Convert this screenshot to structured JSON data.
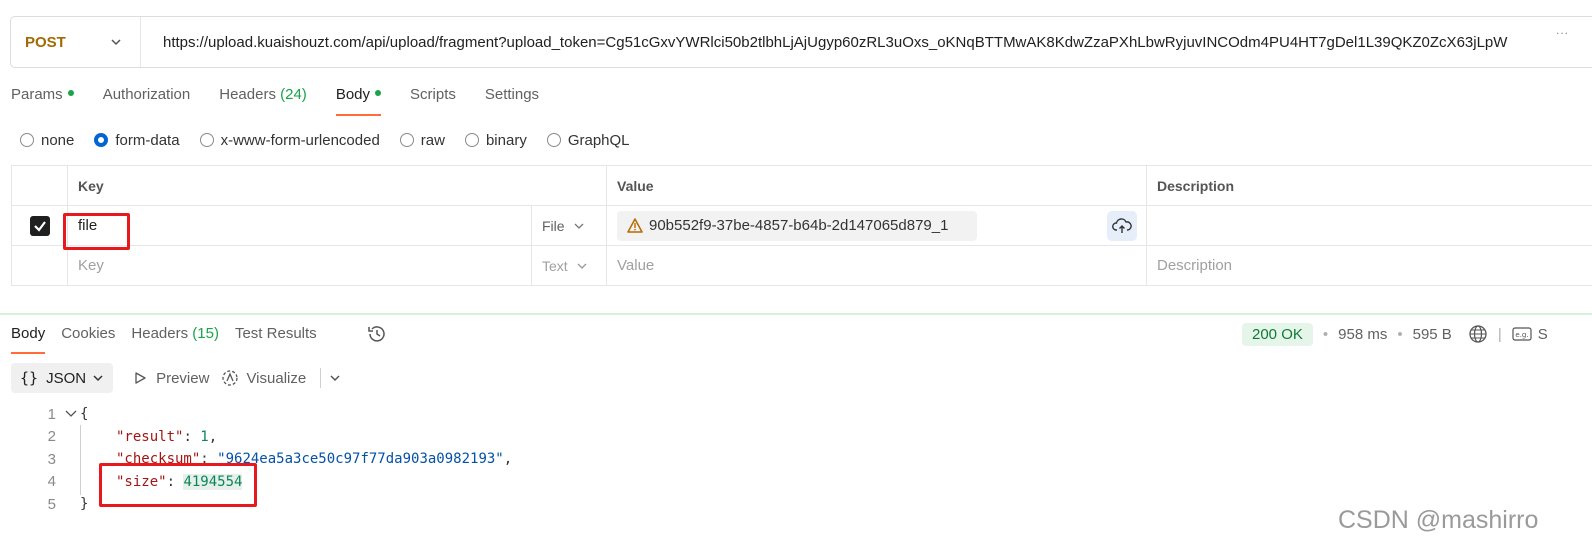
{
  "request": {
    "method": "POST",
    "url": "https://upload.kuaishouzt.com/api/upload/fragment?upload_token=Cg51cGxvYWRlci50b2tlbhLjAjUgyp60zRL3uOxs_oKNqBTTMwAK8KdwZzaPXhLbwRyjuvINCOdm4PU4HT7gDel1L39QKZ0ZcX63jLpW",
    "more": "..."
  },
  "req_tabs": {
    "params": "Params",
    "authorization": "Authorization",
    "headers": "Headers",
    "headers_count": "(24)",
    "body": "Body",
    "scripts": "Scripts",
    "settings": "Settings"
  },
  "body_types": {
    "none": "none",
    "form_data": "form-data",
    "urlencoded": "x-www-form-urlencoded",
    "raw": "raw",
    "binary": "binary",
    "graphql": "GraphQL",
    "selected": "form-data"
  },
  "kv_table": {
    "headers": {
      "key": "Key",
      "value": "Value",
      "description": "Description"
    },
    "row": {
      "key": "file",
      "type": "File",
      "value": "90b552f9-37be-4857-b64b-2d147065d879_1",
      "description": ""
    },
    "empty_row": {
      "key": "Key",
      "type": "Text",
      "value": "Value",
      "description": "Description"
    }
  },
  "response": {
    "tabs": {
      "body": "Body",
      "cookies": "Cookies",
      "headers": "Headers",
      "headers_count": "(15)",
      "test_results": "Test Results"
    },
    "status": "200 OK",
    "time": "958 ms",
    "size": "595 B",
    "save_trunc": "S",
    "format": "JSON",
    "preview": "Preview",
    "visualize": "Visualize",
    "lines": {
      "n1": "1",
      "n2": "2",
      "n3": "3",
      "n4": "4",
      "n5": "5",
      "open": "{",
      "k_result": "\"result\"",
      "v_result": "1",
      "k_checksum": "\"checksum\"",
      "v_checksum": "\"9624ea5a3ce50c97f77da903a0982193\"",
      "k_size": "\"size\"",
      "v_size": "4194554",
      "close": "}"
    }
  },
  "watermark": "CSDN @mashirro",
  "colors": {
    "accent": "#ff6c37",
    "method": "#a26a00",
    "status_ok": "#117a37",
    "highlight": "#e8191c"
  }
}
